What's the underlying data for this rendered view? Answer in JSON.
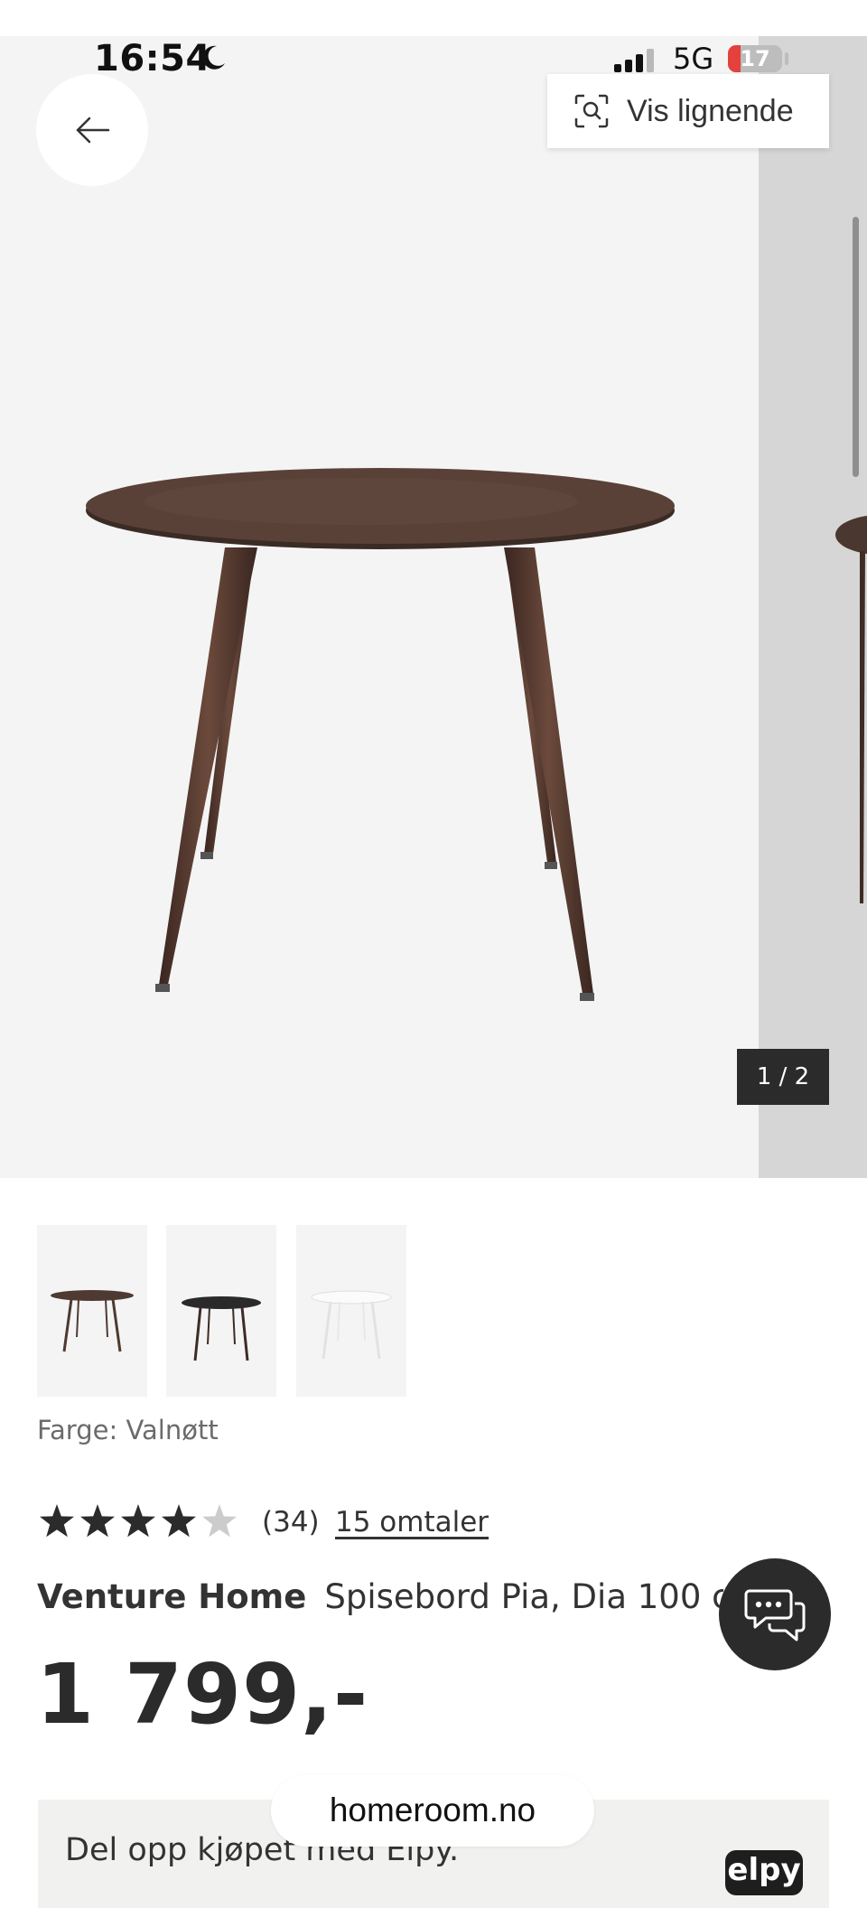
{
  "status_bar": {
    "time": "16:54",
    "moon_icon": "moon-icon",
    "signal_icon": "signal-bars-icon",
    "network": "5G",
    "battery": "17"
  },
  "gallery": {
    "back_icon": "arrow-left-icon",
    "similar_icon": "visual-search-icon",
    "similar_label": "Vis lignende",
    "counter": "1 / 2",
    "thumbnails": [
      {
        "variant": "walnut",
        "top_color": "#4e3a32",
        "leg_color": "#4e3a32"
      },
      {
        "variant": "black",
        "top_color": "#2a2a2a",
        "leg_color": "#3d2c25"
      },
      {
        "variant": "white",
        "top_color": "#f7f7f7",
        "leg_color": "#e2e2e2"
      }
    ]
  },
  "product": {
    "color_label": "Farge: Valnøtt",
    "rating": 4,
    "rating_max": 5,
    "rating_count": "(34)",
    "reviews_link": "15 omtaler",
    "brand": "Venture Home",
    "name": "Spisebord Pia, Dia 100 cm",
    "price": "1 799,-"
  },
  "chat": {
    "icon": "chat-bubbles-icon"
  },
  "financing": {
    "text": "Del opp kjøpet med Elpy.",
    "logo": "elpy"
  },
  "browser": {
    "domain": "homeroom.no"
  },
  "colors": {
    "dark": "#2b2b2b",
    "hero_bg": "#f4f4f4",
    "star_filled": "#2b2b2b",
    "star_empty": "#cccccc",
    "battery_low": "#e4413c"
  }
}
